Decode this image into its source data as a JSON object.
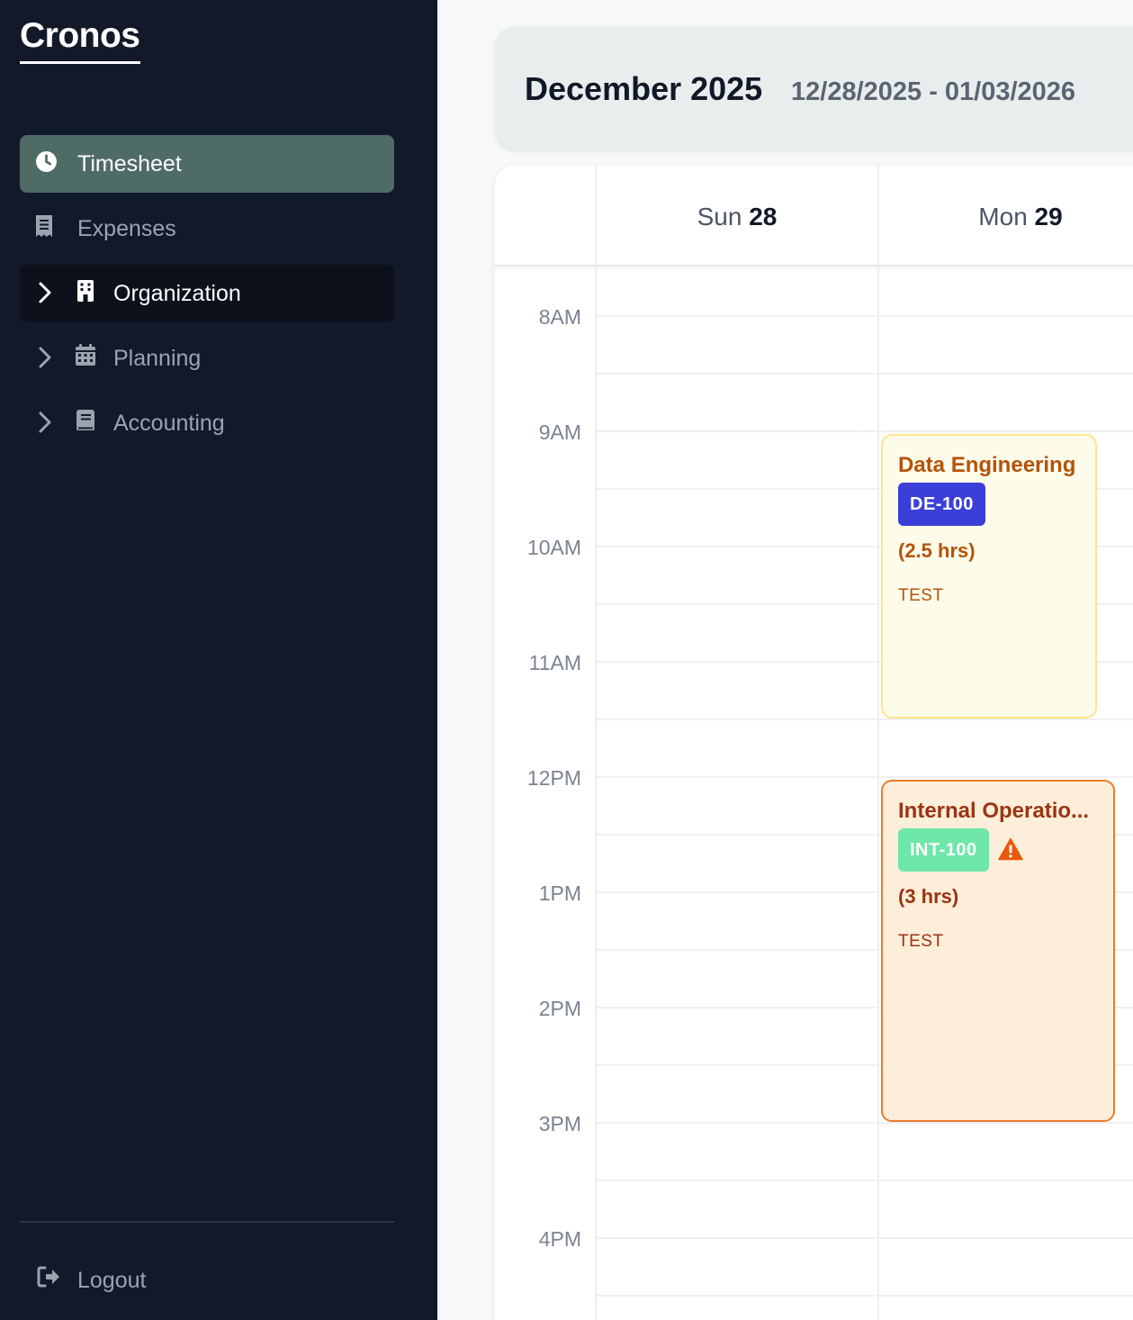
{
  "app": {
    "title": "Cronos"
  },
  "sidebar": {
    "items": [
      {
        "label": "Timesheet",
        "icon": "clock-icon"
      },
      {
        "label": "Expenses",
        "icon": "receipt-icon"
      },
      {
        "label": "Organization",
        "icon": "building-icon"
      },
      {
        "label": "Planning",
        "icon": "calendar-icon"
      },
      {
        "label": "Accounting",
        "icon": "book-icon"
      }
    ],
    "logout": "Logout"
  },
  "header": {
    "month": "December 2025",
    "range": "12/28/2025 - 01/03/2026"
  },
  "calendar": {
    "days": [
      {
        "name": "Sun",
        "num": "28"
      },
      {
        "name": "Mon",
        "num": "29"
      }
    ],
    "hours": [
      "8AM",
      "9AM",
      "10AM",
      "11AM",
      "12PM",
      "1PM",
      "2PM",
      "3PM",
      "4PM"
    ],
    "events": [
      {
        "title": "Data Engineering",
        "code": "DE-100",
        "hours": "(2.5 hrs)",
        "note": "TEST",
        "title_color": "#b45309",
        "code_color": "#3b3fd9",
        "bg_color": "#fefbea",
        "border_color": "#fde68a"
      },
      {
        "title": "Internal Operatio...",
        "code": "INT-100",
        "hours": "(3 hrs)",
        "note": "TEST",
        "warning": true,
        "title_color": "#9a3412",
        "code_color": "#6ee7a8",
        "bg_color": "#fdeed9",
        "border_color": "#ea7c2b"
      }
    ]
  },
  "colors": {
    "sidebar_bg": "#121a2a",
    "active_item": "#4f6b66",
    "warning": "#ea580c"
  }
}
